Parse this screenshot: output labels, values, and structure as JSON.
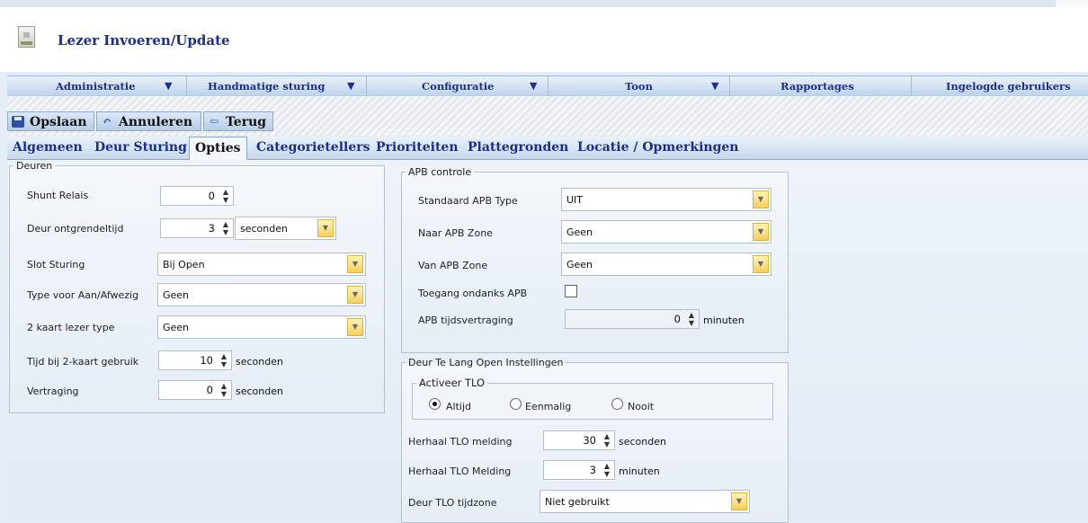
{
  "window": {
    "title": "Lezer Invoeren/Update"
  },
  "menu": {
    "items": [
      {
        "label": "Administratie",
        "has_arrow": true
      },
      {
        "label": "Handmatige sturing",
        "has_arrow": true
      },
      {
        "label": "Configuratie",
        "has_arrow": true
      },
      {
        "label": "Toon",
        "has_arrow": true
      },
      {
        "label": "Rapportages",
        "has_arrow": false
      },
      {
        "label": "Ingelogde gebruikers",
        "has_arrow": false
      }
    ],
    "arrow_glyph": "▼"
  },
  "toolbar": {
    "save_label": "Opslaan",
    "cancel_label": "Annuleren",
    "back_label": "Terug"
  },
  "tabs": {
    "items": [
      "Algemeen",
      "Deur Sturing",
      "Opties",
      "Categorietellers",
      "Prioriteiten",
      "Plattegronden",
      "Locatie / Opmerkingen"
    ],
    "active": "Opties"
  },
  "deuren": {
    "legend": "Deuren",
    "shunt_relais": {
      "label": "Shunt Relais",
      "value": "0"
    },
    "deur_ontgrendeltijd": {
      "label": "Deur ontgrendeltijd",
      "value": "3",
      "unit_select": "seconden"
    },
    "slot_sturing": {
      "label": "Slot Sturing",
      "value": "Bij Open"
    },
    "type_aan_afwezig": {
      "label": "Type voor Aan/Afwezig",
      "value": "Geen"
    },
    "kaart_lezer_type": {
      "label": "2 kaart lezer type",
      "value": "Geen"
    },
    "tijd_2kaart": {
      "label": "Tijd bij 2-kaart gebruik",
      "value": "10",
      "unit": "seconden"
    },
    "vertraging": {
      "label": "Vertraging",
      "value": "0",
      "unit": "seconden"
    }
  },
  "apb": {
    "legend": "APB controle",
    "standaard_type": {
      "label": "Standaard APB Type",
      "value": "UIT"
    },
    "naar_zone": {
      "label": "Naar APB Zone",
      "value": "Geen"
    },
    "van_zone": {
      "label": "Van APB Zone",
      "value": "Geen"
    },
    "toegang_ondanks": {
      "label": "Toegang ondanks APB",
      "checked": false
    },
    "tijdsvertraging": {
      "label": "APB tijdsvertraging",
      "value": "0",
      "unit": "minuten"
    }
  },
  "tlo": {
    "legend": "Deur Te Lang Open Instellingen",
    "activeer": {
      "legend": "Activeer TLO",
      "options": [
        "Altijd",
        "Eenmalig",
        "Nooit"
      ],
      "selected": "Altijd"
    },
    "herhaal_melding_sec": {
      "label": "Herhaal TLO melding",
      "value": "30",
      "unit": "seconden"
    },
    "herhaal_melding_min": {
      "label": "Herhaal TLO Melding",
      "value": "3",
      "unit": "minuten"
    },
    "tijdzone": {
      "label": "Deur TLO tijdzone",
      "value": "Niet gebruikt"
    }
  },
  "glyphs": {
    "spin": "▲\n▼",
    "dropdown": "▼"
  },
  "icons": {
    "save": "floppy-disk-icon",
    "cancel": "undo-arrow-icon",
    "back": "back-arrow-icon",
    "page": "document-icon"
  }
}
